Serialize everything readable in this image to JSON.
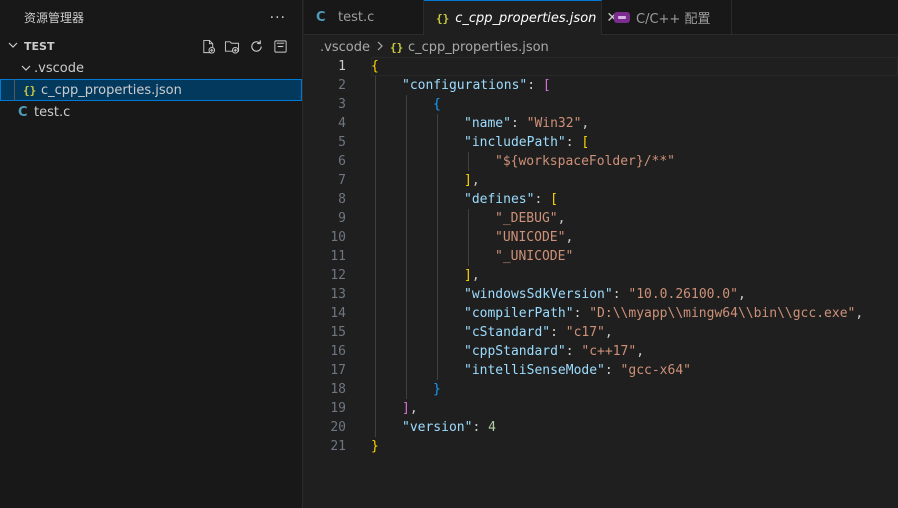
{
  "sidebar": {
    "title": "资源管理器",
    "more": "···",
    "section": {
      "title": "TEST"
    },
    "tree": {
      "folder": ".vscode",
      "file_json": "c_cpp_properties.json",
      "file_c": "test.c",
      "json_icon": "{}",
      "c_icon": "C"
    }
  },
  "tabs": [
    {
      "label": "test.c",
      "icon": "C"
    },
    {
      "label": "c_cpp_properties.json",
      "icon": "{}"
    },
    {
      "label": "C/C++ 配置"
    }
  ],
  "breadcrumb": {
    "folder": ".vscode",
    "file": "c_cpp_properties.json",
    "icon": "{}"
  },
  "editor": {
    "active_line": 1,
    "lines": [
      [
        [
          "{",
          "tk-brace1"
        ]
      ],
      [
        [
          "\"configurations\"",
          "tk-key"
        ],
        [
          ": ",
          "tk-punct"
        ],
        [
          "[",
          "tk-brace2"
        ]
      ],
      [
        [
          "{",
          "tk-brace3"
        ]
      ],
      [
        [
          "\"name\"",
          "tk-key"
        ],
        [
          ": ",
          "tk-punct"
        ],
        [
          "\"Win32\"",
          "tk-str"
        ],
        [
          ",",
          "tk-punct"
        ]
      ],
      [
        [
          "\"includePath\"",
          "tk-key"
        ],
        [
          ": ",
          "tk-punct"
        ],
        [
          "[",
          "tk-brace1"
        ]
      ],
      [
        [
          "\"${workspaceFolder}/**\"",
          "tk-str"
        ]
      ],
      [
        [
          "]",
          "tk-brace1"
        ],
        [
          ",",
          "tk-punct"
        ]
      ],
      [
        [
          "\"defines\"",
          "tk-key"
        ],
        [
          ": ",
          "tk-punct"
        ],
        [
          "[",
          "tk-brace1"
        ]
      ],
      [
        [
          "\"_DEBUG\"",
          "tk-str"
        ],
        [
          ",",
          "tk-punct"
        ]
      ],
      [
        [
          "\"UNICODE\"",
          "tk-str"
        ],
        [
          ",",
          "tk-punct"
        ]
      ],
      [
        [
          "\"_UNICODE\"",
          "tk-str"
        ]
      ],
      [
        [
          "]",
          "tk-brace1"
        ],
        [
          ",",
          "tk-punct"
        ]
      ],
      [
        [
          "\"windowsSdkVersion\"",
          "tk-key"
        ],
        [
          ": ",
          "tk-punct"
        ],
        [
          "\"10.0.26100.0\"",
          "tk-str"
        ],
        [
          ",",
          "tk-punct"
        ]
      ],
      [
        [
          "\"compilerPath\"",
          "tk-key"
        ],
        [
          ": ",
          "tk-punct"
        ],
        [
          "\"D:\\\\myapp\\\\mingw64\\\\bin\\\\gcc.exe\"",
          "tk-str"
        ],
        [
          ",",
          "tk-punct"
        ]
      ],
      [
        [
          "\"cStandard\"",
          "tk-key"
        ],
        [
          ": ",
          "tk-punct"
        ],
        [
          "\"c17\"",
          "tk-str"
        ],
        [
          ",",
          "tk-punct"
        ]
      ],
      [
        [
          "\"cppStandard\"",
          "tk-key"
        ],
        [
          ": ",
          "tk-punct"
        ],
        [
          "\"c++17\"",
          "tk-str"
        ],
        [
          ",",
          "tk-punct"
        ]
      ],
      [
        [
          "\"intelliSenseMode\"",
          "tk-key"
        ],
        [
          ": ",
          "tk-punct"
        ],
        [
          "\"gcc-x64\"",
          "tk-str"
        ]
      ],
      [
        [
          "}",
          "tk-brace3"
        ]
      ],
      [
        [
          "]",
          "tk-brace2"
        ],
        [
          ",",
          "tk-punct"
        ]
      ],
      [
        [
          "\"version\"",
          "tk-key"
        ],
        [
          ": ",
          "tk-punct"
        ],
        [
          "4",
          "tk-num"
        ]
      ],
      [
        [
          "}",
          "tk-brace1"
        ]
      ]
    ]
  }
}
